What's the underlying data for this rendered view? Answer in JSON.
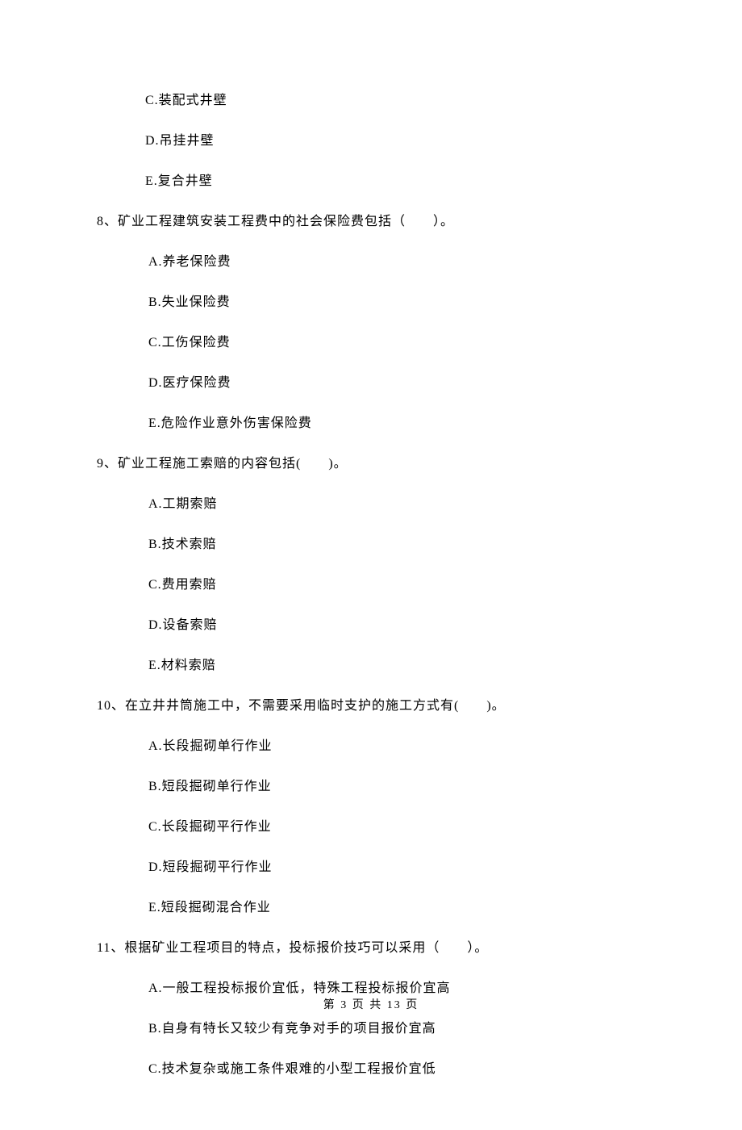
{
  "orphan_options": [
    "C.装配式井壁",
    "D.吊挂井壁",
    "E.复合井壁"
  ],
  "questions": [
    {
      "number": "8、",
      "stem": "矿业工程建筑安装工程费中的社会保险费包括（　　）。",
      "options": [
        "A.养老保险费",
        "B.失业保险费",
        "C.工伤保险费",
        "D.医疗保险费",
        "E.危险作业意外伤害保险费"
      ]
    },
    {
      "number": "9、",
      "stem": "矿业工程施工索赔的内容包括(　　)。",
      "options": [
        "A.工期索赔",
        "B.技术索赔",
        "C.费用索赔",
        "D.设备索赔",
        "E.材料索赔"
      ]
    },
    {
      "number": "10、",
      "stem": "在立井井筒施工中，不需要采用临时支护的施工方式有(　　)。",
      "options": [
        "A.长段掘砌单行作业",
        "B.短段掘砌单行作业",
        "C.长段掘砌平行作业",
        "D.短段掘砌平行作业",
        "E.短段掘砌混合作业"
      ]
    },
    {
      "number": "11、",
      "stem": "根据矿业工程项目的特点，投标报价技巧可以采用（　　）。",
      "options": [
        "A.一般工程投标报价宜低，特殊工程投标报价宜高",
        "B.自身有特长又较少有竞争对手的项目报价宜高",
        "C.技术复杂或施工条件艰难的小型工程报价宜低"
      ]
    }
  ],
  "footer": "第 3 页 共 13 页"
}
